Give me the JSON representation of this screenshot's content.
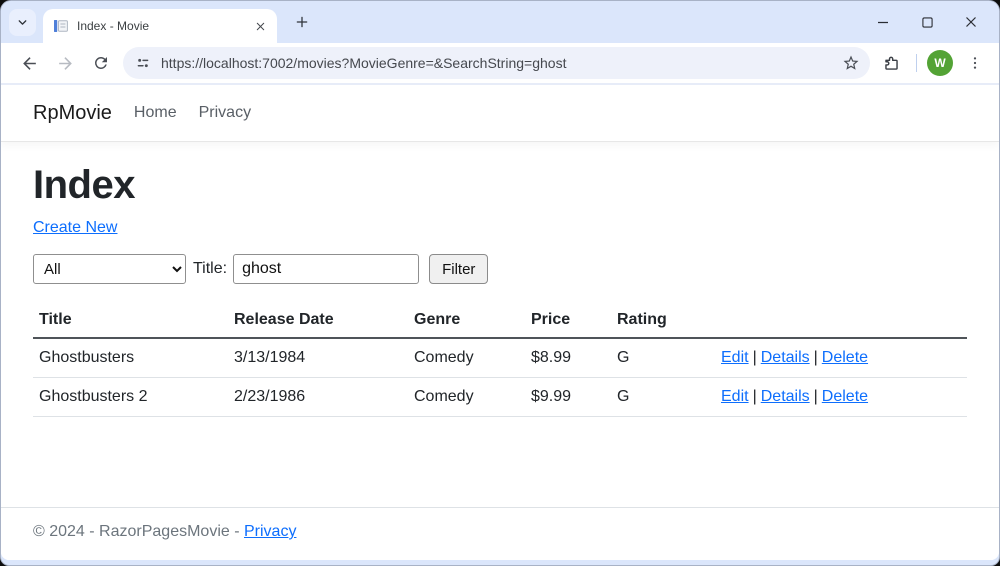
{
  "browser": {
    "tab": {
      "title": "Index - Movie"
    },
    "toolbar": {
      "url": "https://localhost:7002/movies?MovieGenre=&SearchString=ghost",
      "avatar_letter": "W",
      "avatar_color": "#53a335"
    }
  },
  "navbar": {
    "brand": "RpMovie",
    "links": {
      "home": "Home",
      "privacy": "Privacy"
    }
  },
  "main": {
    "heading": "Index",
    "create_link": "Create New",
    "filter": {
      "genre_value": "All",
      "title_label": "Title:",
      "search_value": "ghost",
      "button_label": "Filter"
    },
    "table": {
      "headers": [
        "Title",
        "Release Date",
        "Genre",
        "Price",
        "Rating"
      ],
      "action_separator": "|",
      "rows": [
        {
          "title": "Ghostbusters",
          "release_date": "3/13/1984",
          "genre": "Comedy",
          "price": "$8.99",
          "rating": "G",
          "actions": [
            "Edit",
            "Details",
            "Delete"
          ]
        },
        {
          "title": "Ghostbusters 2",
          "release_date": "2/23/1986",
          "genre": "Comedy",
          "price": "$9.99",
          "rating": "G",
          "actions": [
            "Edit",
            "Details",
            "Delete"
          ]
        }
      ]
    }
  },
  "footer": {
    "copyright": "© 2024 - RazorPagesMovie -",
    "privacy_link": "Privacy"
  }
}
